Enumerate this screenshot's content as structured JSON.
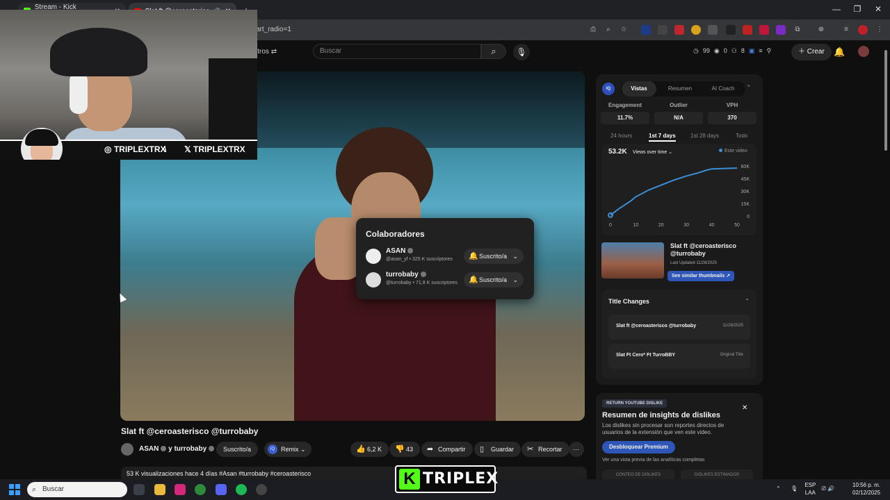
{
  "browser": {
    "tabs": [
      {
        "label": "Stream - Kick Dashboard",
        "favicon_color": "#53fc18"
      },
      {
        "label": "Slat ft @ceroasterisco @tu",
        "favicon_color": "#ff0000"
      }
    ],
    "url_fragment": "art_radio=1"
  },
  "yt_header": {
    "filters_label": "ltros",
    "search_placeholder": "Buscar",
    "counters": [
      "99",
      "0",
      "8"
    ],
    "create_label": "Crear"
  },
  "webcam": {
    "instagram": "TRIPLEXTRX",
    "separator": "\\",
    "x_handle": "TRIPLEXTRX"
  },
  "collaborators": {
    "title": "Colaboradores",
    "items": [
      {
        "name": "ASAN",
        "sub": "@asan_yf • 325 K suscriptores",
        "button": "Suscrito/a"
      },
      {
        "name": "turrobaby",
        "sub": "@turrobaby • 71,8 K suscriptores",
        "button": "Suscrito/a"
      }
    ]
  },
  "video": {
    "title": "Slat ft @ceroasterisco @turrobaby",
    "channel": "ASAN",
    "channel_suffix": "y turrobaby",
    "subscribe_label": "Suscrito/a",
    "remix_label": "Remix",
    "likes": "6,2 K",
    "dislikes": "43",
    "share_label": "Compartir",
    "save_label": "Guardar",
    "clip_label": "Recortar",
    "meta": "53 K visualizaciones  hace 4 días  #Asan #turrobaby #ceroasterisco"
  },
  "iq": {
    "logo": "IQ",
    "tabs": [
      "Vistas",
      "Resumen",
      "AI Coach"
    ],
    "active_tab": 0,
    "metrics": [
      {
        "label": "Engagement",
        "value": "11.7%"
      },
      {
        "label": "Outlier",
        "value": "N/A"
      },
      {
        "label": "VPH",
        "value": "370"
      }
    ],
    "ranges": [
      "24 hours",
      "1st 7 days",
      "1st 28 days",
      "Todo"
    ],
    "active_range": 1,
    "total_views": "53.2K",
    "chart_mode": "Views over time",
    "legend": "Este video",
    "related": {
      "title": "Slat ft @ceroasterisco @turrobaby",
      "updated": "Last Updated 11/28/2025",
      "button": "See similar thumbnails"
    },
    "title_changes": {
      "heading": "Title Changes",
      "rows": [
        {
          "title": "Slat ft @ceroasterisco @turrobaby",
          "date": "11/28/2025"
        },
        {
          "title": "Slat Ft Cero* Ft TurroBBY",
          "date": "Original Title"
        }
      ]
    }
  },
  "chart_data": {
    "type": "line",
    "x": [
      0,
      3,
      5,
      8,
      10,
      15,
      20,
      25,
      30,
      35,
      38,
      40,
      45,
      50
    ],
    "y": [
      1000,
      8000,
      12000,
      18000,
      23000,
      31000,
      37000,
      43000,
      48000,
      52000,
      55000,
      56500,
      57000,
      57500
    ],
    "xticks": [
      "0",
      "10",
      "20",
      "30",
      "40",
      "50"
    ],
    "yticks": [
      "60K",
      "45K",
      "30K",
      "15K",
      "0"
    ],
    "xlim": [
      0,
      50
    ],
    "ylim": [
      0,
      60000
    ],
    "series_color": "#3b8fd6"
  },
  "ryd": {
    "tag": "RETURN YOUTUBE DISLIKE",
    "title": "Resumen de insights de dislikes",
    "desc": "Los dislikes sin procesar son reportes directos de usuarios de la extensión que ven este video.",
    "button": "Desbloquear Premium",
    "note": "Ver una vista previa de las analíticas completas",
    "chips": [
      "CONTEO DE DISLIKES",
      "DISLIKES ESTIMADOS"
    ]
  },
  "taskbar": {
    "search_placeholder": "Buscar",
    "lang_top": "ESP",
    "lang_bottom": "LAA",
    "time": "10:56 p. m.",
    "date": "02/12/2025"
  },
  "kick_logo": {
    "letter": "K",
    "text": "TRIPLEX"
  }
}
